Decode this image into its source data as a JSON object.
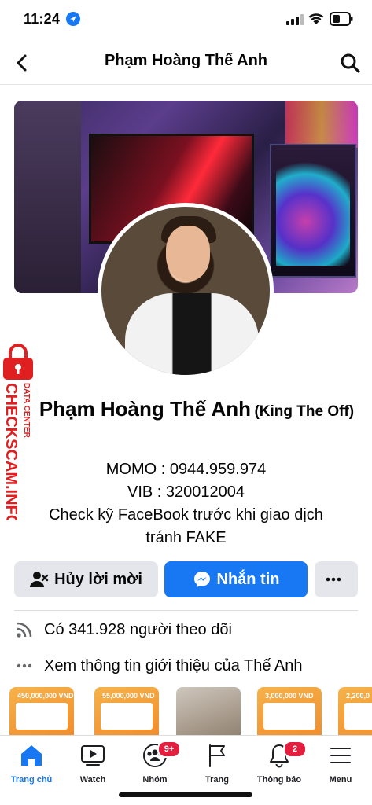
{
  "status_bar": {
    "time": "11:24"
  },
  "header": {
    "title": "Phạm Hoàng Thế Anh"
  },
  "profile": {
    "name": "Phạm Hoàng Thế Anh",
    "alt_name": "(King The Off)",
    "bio_lines": [
      "MOMO : 0944.959.974",
      "VIB : 320012004",
      "Check kỹ FaceBook trước khi giao dịch",
      "tránh FAKE"
    ]
  },
  "watermark": {
    "line1": "CHECKSCAM.INFO",
    "line2": "DATA CENTER"
  },
  "actions": {
    "cancel_label": "Hủy lời mời",
    "message_label": "Nhắn tin"
  },
  "info": {
    "followers": "Có 341.928 người theo dõi",
    "about": "Xem thông tin giới thiệu của Thế Anh"
  },
  "photos": [
    {
      "amount": "450,000,000 VND"
    },
    {
      "amount": "55,000,000 VND"
    },
    {
      "amount": ""
    },
    {
      "amount": "3,000,000 VND"
    },
    {
      "amount": "2,200,0"
    }
  ],
  "tabs": [
    {
      "label": "Trang chủ",
      "icon": "home-icon",
      "active": true
    },
    {
      "label": "Watch",
      "icon": "video-icon"
    },
    {
      "label": "Nhóm",
      "icon": "groups-icon",
      "badge": "9+"
    },
    {
      "label": "Trang",
      "icon": "flag-icon"
    },
    {
      "label": "Thông báo",
      "icon": "bell-icon",
      "badge": "2"
    },
    {
      "label": "Menu",
      "icon": "menu-icon"
    }
  ],
  "colors": {
    "accent": "#1877f2",
    "badge": "#e41e3f",
    "button_gray": "#e4e6eb",
    "watermark": "#e02020"
  }
}
